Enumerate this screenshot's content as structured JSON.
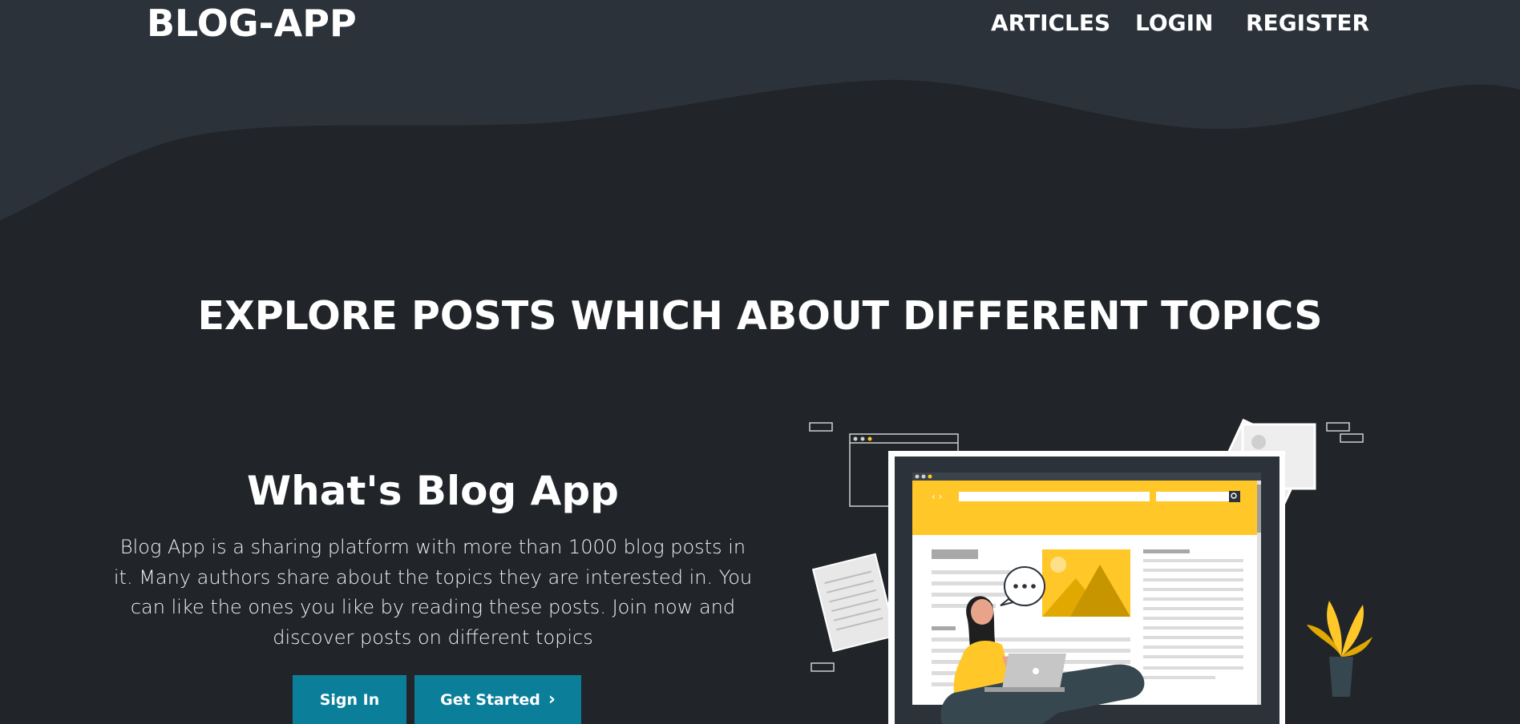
{
  "brand": "BLOG-APP",
  "nav": {
    "items": [
      "ARTICLES",
      "LOGIN",
      "REGISTER"
    ]
  },
  "hero": {
    "title": "EXPLORE POSTS WHICH ABOUT DIFFERENT TOPICS"
  },
  "about": {
    "title": "What's Blog App",
    "description": "Blog App is a sharing platform with more than 1000 blog posts in it. Many authors share about the topics they are interested in. You can like the ones you like by reading these posts. Join now and discover posts on different topics",
    "signin_label": "Sign In",
    "get_started_label": "Get Started",
    "chevron_icon": "chevron-right-icon"
  },
  "colors": {
    "background": "#212529",
    "wave": "#2b323a",
    "button": "#0b7f99",
    "accent_yellow": "#ffc727"
  }
}
